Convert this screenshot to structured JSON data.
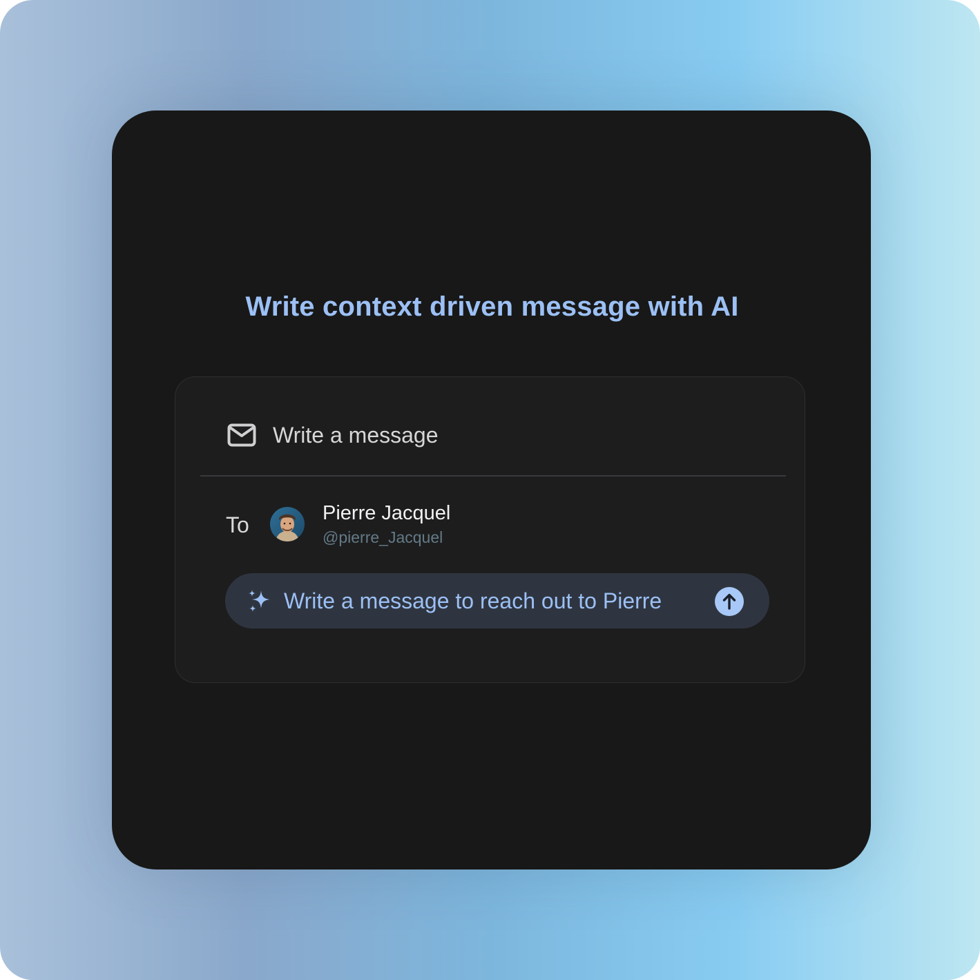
{
  "headline": "Write context driven message with AI",
  "composer": {
    "icon": "mail-icon",
    "label": "Write a message"
  },
  "recipient": {
    "to_label": "To",
    "avatar_icon": "avatar-photo",
    "name": "Pierre Jacquel",
    "handle": "@pierre_Jacquel"
  },
  "ai_prompt": {
    "icon": "sparkle-icon",
    "text": "Write a message to reach out to Pierre",
    "send_icon": "arrow-up-icon"
  },
  "colors": {
    "accent": "#9cc0f5",
    "panel": "#181818",
    "card": "#1d1d1e",
    "pill": "#2f3540",
    "send": "#a8c9f7"
  }
}
